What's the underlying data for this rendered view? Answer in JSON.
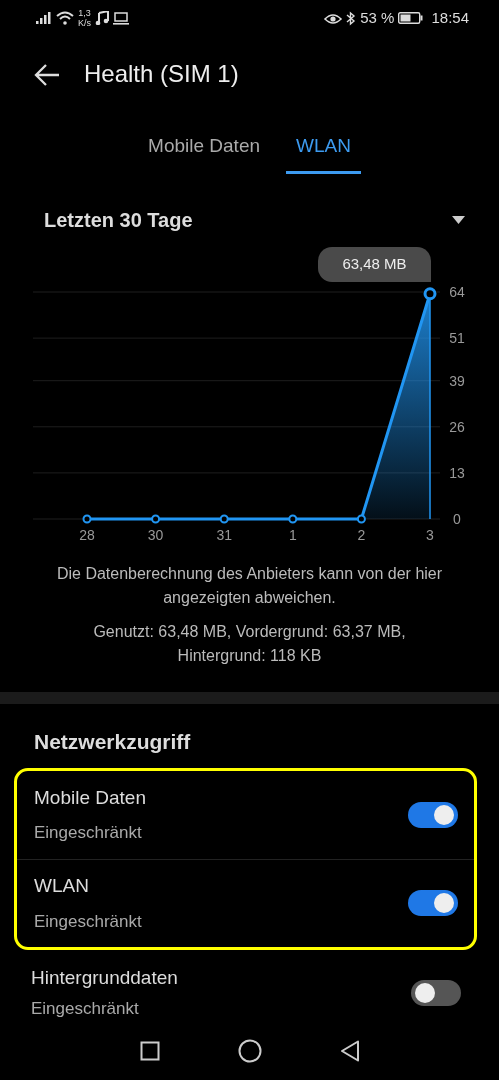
{
  "status_bar": {
    "net_speed_value": "1,3",
    "net_speed_unit": "K/s",
    "battery": "53 %",
    "time": "18:54"
  },
  "header": {
    "title": "Health (SIM 1)"
  },
  "tabs": [
    {
      "label": "Mobile Daten",
      "selected": false
    },
    {
      "label": "WLAN",
      "selected": true
    }
  ],
  "period": {
    "value": "Letzten 30 Tage"
  },
  "chart": {
    "tooltip": "63,48 MB",
    "chart_data": {
      "type": "area",
      "categories": [
        "28",
        "30",
        "31",
        "1",
        "2",
        "3"
      ],
      "values": [
        0,
        0,
        0,
        0,
        0,
        63.5
      ],
      "ylim": [
        0,
        64
      ],
      "yticks": [
        0,
        13,
        26,
        39,
        51,
        64
      ],
      "grid": true
    }
  },
  "note": "Die Datenberechnung des Anbieters kann von der hier angezeigten abweichen.",
  "usage": "Genutzt: 63,48 MB, Vordergrund: 63,37 MB, Hintergrund: 118 KB",
  "section": {
    "title": "Netzwerkzugriff",
    "items": [
      {
        "title": "Mobile Daten",
        "subtitle": "Eingeschränkt",
        "on": true,
        "highlighted": true
      },
      {
        "title": "WLAN",
        "subtitle": "Eingeschränkt",
        "on": true,
        "highlighted": true
      },
      {
        "title": "Hintergrunddaten",
        "subtitle": "Eingeschränkt",
        "on": false,
        "highlighted": false
      }
    ]
  }
}
